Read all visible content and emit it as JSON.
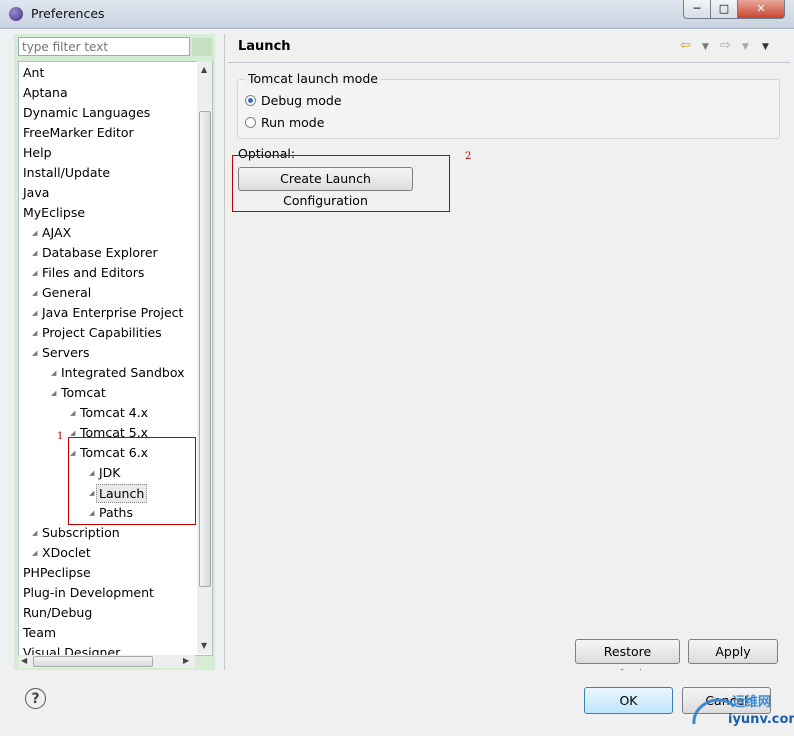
{
  "window": {
    "title": "Preferences",
    "min": "0",
    "max": "1",
    "close": "x"
  },
  "filter": {
    "placeholder": "type filter text"
  },
  "tree": [
    {
      "label": "Ant",
      "depth": 0
    },
    {
      "label": "Aptana",
      "depth": 0
    },
    {
      "label": "Dynamic Languages",
      "depth": 0
    },
    {
      "label": "FreeMarker Editor",
      "depth": 0
    },
    {
      "label": "Help",
      "depth": 0
    },
    {
      "label": "Install/Update",
      "depth": 0
    },
    {
      "label": "Java",
      "depth": 0
    },
    {
      "label": "MyEclipse",
      "depth": 0
    },
    {
      "label": "AJAX",
      "depth": 1
    },
    {
      "label": "Database Explorer",
      "depth": 1
    },
    {
      "label": "Files and Editors",
      "depth": 1
    },
    {
      "label": "General",
      "depth": 1
    },
    {
      "label": "Java Enterprise Project",
      "depth": 1
    },
    {
      "label": "Project Capabilities",
      "depth": 1
    },
    {
      "label": "Servers",
      "depth": 1
    },
    {
      "label": "Integrated Sandbox",
      "depth": 2
    },
    {
      "label": "Tomcat",
      "depth": 2
    },
    {
      "label": "Tomcat  4.x",
      "depth": 3
    },
    {
      "label": "Tomcat  5.x",
      "depth": 3
    },
    {
      "label": "Tomcat  6.x",
      "depth": 3
    },
    {
      "label": "JDK",
      "depth": 4
    },
    {
      "label": "Launch",
      "depth": 4,
      "selected": true
    },
    {
      "label": "Paths",
      "depth": 4
    },
    {
      "label": "Subscription",
      "depth": 1
    },
    {
      "label": "XDoclet",
      "depth": 1
    },
    {
      "label": "PHPeclipse",
      "depth": 0
    },
    {
      "label": "Plug-in Development",
      "depth": 0
    },
    {
      "label": "Run/Debug",
      "depth": 0
    },
    {
      "label": "Team",
      "depth": 0
    },
    {
      "label": "Visual Designer",
      "depth": 0
    }
  ],
  "page": {
    "title": "Launch",
    "group_label": "Tomcat launch mode",
    "debug_mode": "Debug mode",
    "run_mode": "Run mode",
    "optional_label": "Optional:",
    "create_config_button": "Create Launch Configuration"
  },
  "annotations": {
    "one": "1",
    "two": "2"
  },
  "buttons": {
    "restore_defaults": "Restore Defaults",
    "apply": "Apply",
    "ok": "OK",
    "cancel": "Cancel",
    "help": "?"
  },
  "watermark": {
    "line1": "运维网",
    "line2": "iyunv.com"
  },
  "icons": {
    "back": "arrow-left-icon",
    "forward": "arrow-right-icon",
    "menu": "chevron-down-icon"
  }
}
